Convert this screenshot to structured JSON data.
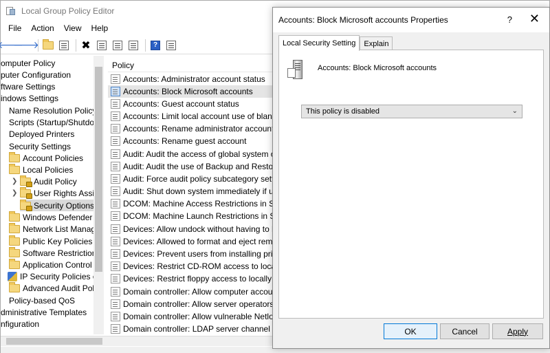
{
  "window": {
    "title": "Local Group Policy Editor"
  },
  "menu": [
    "File",
    "Action",
    "View",
    "Help"
  ],
  "toolbar": {
    "help_label": "?"
  },
  "tree": {
    "items": [
      "omputer Policy",
      "puter Configuration",
      "ftware Settings",
      "indows Settings",
      "Name Resolution Policy",
      "Scripts (Startup/Shutdov",
      "Deployed Printers",
      "Security Settings",
      "Account Policies",
      "Local Policies",
      "Audit Policy",
      "User Rights Assig",
      "Security Options",
      "Windows Defender F",
      "Network List Manag",
      "Public Key Policies",
      "Software Restriction",
      "Application Control I",
      "IP Security Policies o",
      "Advanced Audit Poli",
      "Policy-based QoS",
      "dministrative Templates",
      "nfiguration"
    ]
  },
  "list": {
    "header": "Policy",
    "rows": [
      "Accounts: Administrator account status",
      "Accounts: Block Microsoft accounts",
      "Accounts: Guest account status",
      "Accounts: Limit local account use of blank",
      "Accounts: Rename administrator account",
      "Accounts: Rename guest account",
      "Audit: Audit the access of global system ob",
      "Audit: Audit the use of Backup and Restore",
      "Audit: Force audit policy subcategory settin",
      "Audit: Shut down system immediately if un",
      "DCOM: Machine Access Restrictions in Secu",
      "DCOM: Machine Launch Restrictions in Sec",
      "Devices: Allow undock without having to lo",
      "Devices: Allowed to format and eject remov",
      "Devices: Prevent users from installing printe",
      "Devices: Restrict CD-ROM access to locally l",
      "Devices: Restrict floppy access to locally log",
      "Domain controller: Allow computer accoun",
      "Domain controller: Allow server operators t",
      "Domain controller: Allow vulnerable Netlog",
      "Domain controller: LDAP server channel bir"
    ]
  },
  "dialog": {
    "title": "Accounts: Block Microsoft accounts Properties",
    "help": "?",
    "close": "✕",
    "tabs": [
      "Local Security Setting",
      "Explain"
    ],
    "policy_name": "Accounts: Block Microsoft accounts",
    "dropdown_value": "This policy is disabled",
    "ok": "OK",
    "cancel": "Cancel",
    "apply": "Apply"
  }
}
